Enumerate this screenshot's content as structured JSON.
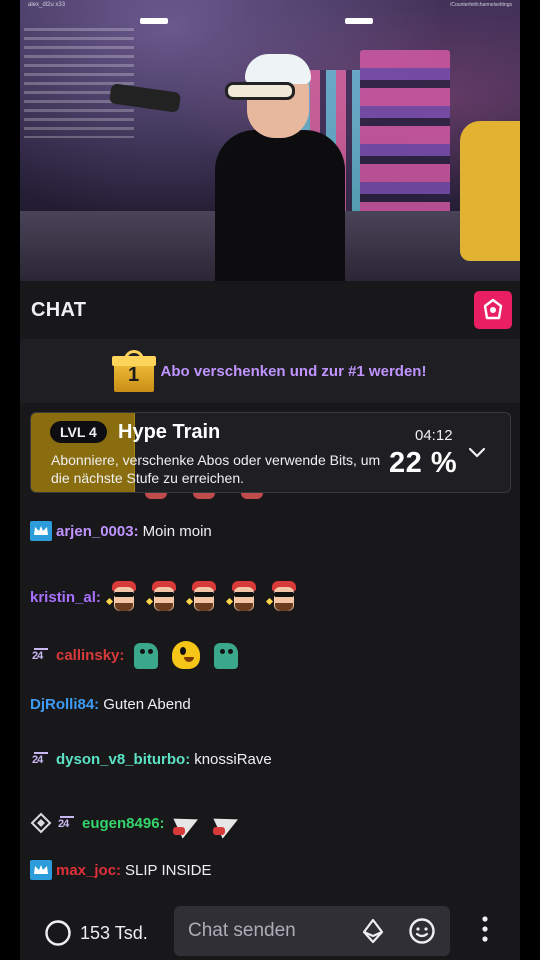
{
  "video": {
    "top_left_text": "alex_dl2u x33",
    "top_right_text": "/Counterfeit/channelsettings"
  },
  "chat": {
    "title": "CHAT",
    "promo": {
      "gift_number": "1",
      "text": "Abo verschenken und zur #1 werden!"
    },
    "hype_train": {
      "level": "LVL 4",
      "title": "Hype Train",
      "description": "Abonniere, verschenke Abos oder verwende Bits, um die nächste Stufe zu erreichen.",
      "timer": "04:12",
      "percent_label": "22 %",
      "progress": 0.22,
      "fill_color": "#8a6d0e"
    },
    "messages": [
      {
        "user": "arjen_0003:",
        "color": "#bf94ff",
        "text": "Moin moin",
        "badges": [
          "prime"
        ],
        "emotes": []
      },
      {
        "user": "kristin_al:",
        "color": "#a970ff",
        "text": "",
        "badges": [],
        "emotes": [
          "guy",
          "guy",
          "guy",
          "guy",
          "guy"
        ]
      },
      {
        "user": "callinsky:",
        "color": "#d83a3a",
        "text": "",
        "badges": [
          "sub-24"
        ],
        "emotes": [
          "dino",
          "blob",
          "dino"
        ]
      },
      {
        "user": "DjRolli84:",
        "color": "#3d9cf5",
        "text": "Guten Abend",
        "badges": [],
        "emotes": []
      },
      {
        "user": "dyson_v8_biturbo:",
        "color": "#5ce1c5",
        "text": "knossiRave",
        "badges": [
          "sub-24"
        ],
        "emotes": []
      },
      {
        "user": "eugen8496:",
        "color": "#35d46a",
        "text": "",
        "badges": [
          "mod",
          "sub-24"
        ],
        "emotes": [
          "horn",
          "horn"
        ]
      },
      {
        "user": "max_joc:",
        "color": "#e0303a",
        "text": "SLIP INSIDE",
        "badges": [
          "prime"
        ],
        "emotes": []
      }
    ],
    "badge_24_label": "24"
  },
  "bottom": {
    "viewers": "153 Tsd.",
    "input_placeholder": "Chat senden"
  },
  "colors": {
    "accent": "#e91e63",
    "promo_text": "#bf94ff",
    "prime_badge": "#2d9cdb"
  },
  "icons": [
    "gift-icon",
    "viewers-icon",
    "bits-icon",
    "emoji-icon",
    "more-vertical-icon",
    "chevron-down-icon"
  ]
}
